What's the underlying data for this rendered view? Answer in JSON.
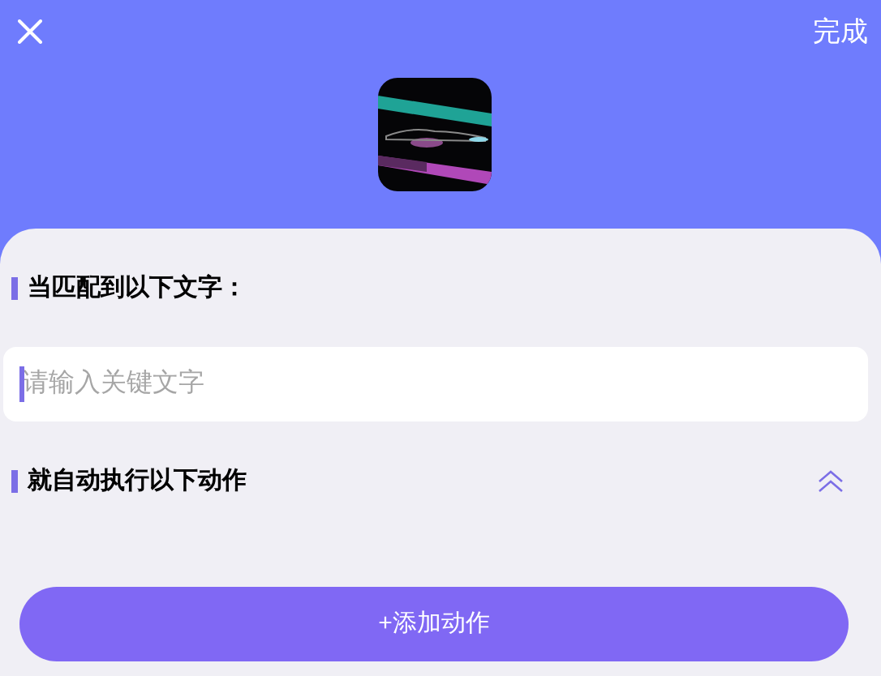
{
  "header": {
    "done_label": "完成"
  },
  "match_section": {
    "title": "当匹配到以下文字：",
    "input": {
      "placeholder": "请输入关键文字"
    }
  },
  "action_section": {
    "title": "就自动执行以下动作",
    "expanded": true
  },
  "add_button": {
    "label": "+添加动作"
  }
}
